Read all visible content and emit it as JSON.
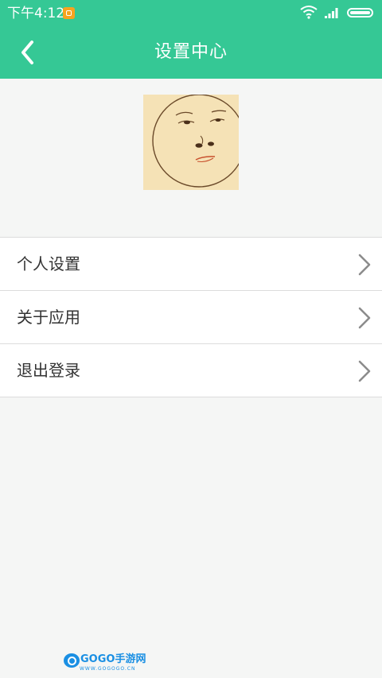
{
  "status_bar": {
    "time": "下午4:12",
    "icons": [
      "notification-icon",
      "wifi-icon",
      "signal-icon",
      "battery-icon"
    ]
  },
  "header": {
    "title": "设置中心",
    "back_icon": "chevron-left-icon",
    "background_color": "#35c895"
  },
  "avatar": {
    "icon": "face-sketch-avatar"
  },
  "menu": {
    "items": [
      {
        "label": "个人设置",
        "icon": "chevron-right-icon"
      },
      {
        "label": "关于应用",
        "icon": "chevron-right-icon"
      },
      {
        "label": "退出登录",
        "icon": "chevron-right-icon"
      }
    ]
  },
  "footer": {
    "logo_text": "GOGO手游网",
    "logo_sub": "WWW.GOGOGO.CN"
  }
}
